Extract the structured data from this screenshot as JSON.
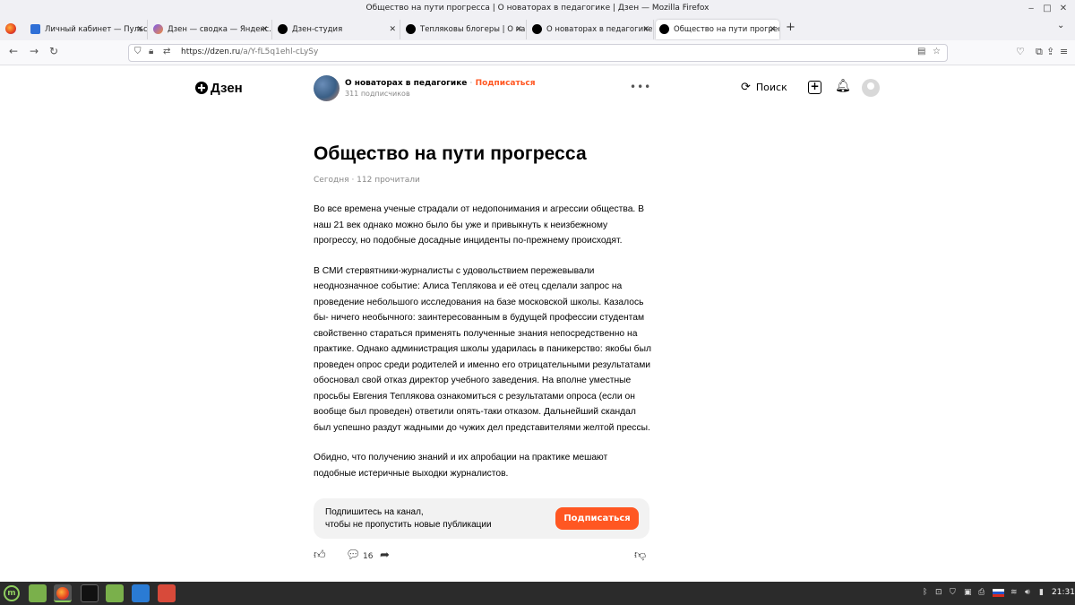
{
  "window": {
    "title": "Общество на пути прогресса | О новаторах в педагогике | Дзен — Mozilla Firefox"
  },
  "tabs": [
    {
      "label": "Личный кабинет — Пульс |",
      "color": "#2f6fd6"
    },
    {
      "label": "Дзен — сводка — Яндекс.",
      "color": "#7b5cf0"
    },
    {
      "label": "Дзен-студия",
      "color": "#000000"
    },
    {
      "label": "Тепляковы блогеры | О на",
      "color": "#000000"
    },
    {
      "label": "О новаторах в педагогике",
      "color": "#000000"
    },
    {
      "label": "Общество на пути прогрес",
      "color": "#000000"
    }
  ],
  "address": {
    "host": "https://dzen.ru",
    "path": "/a/Y-fL5q1ehl-cLySy"
  },
  "site": {
    "logo": "Дзен",
    "channel_name": "О новаторах в педагогике",
    "separator": "·",
    "subscribe_link": "Подписаться",
    "subscribers": "311 подписчиков",
    "search_label": "Поиск",
    "more": "•••"
  },
  "article": {
    "title": "Общество на пути прогресса",
    "meta": "Сегодня · 112 прочитали",
    "paragraphs": [
      "Во все времена ученые страдали от недопонимания и агрессии общества. В наш 21 век однако можно было бы уже и привыкнуть к неизбежному прогрессу, но подобные досадные инциденты по-прежнему происходят.",
      "В СМИ стервятники-журналисты с удовольствием пережевывали неоднозначное событие: Алиса Теплякова и её отец сделали запрос на проведение небольшого исследования на базе московской школы. Казалось бы- ничего необычного: заинтересованным в будущей профессии студентам свойственно стараться применять полученные знания непосредственно на практике. Однако администрация школы ударилась в паникерство: якобы был проведен опрос среди родителей и именно его отрицательными результатами обосновал свой отказ директор учебного заведения. На вполне уместные просьбы Евгения Теплякова ознакомиться с результатами опроса (если он вообще был проведен) ответили опять-таки отказом. Дальнейший скандал был успешно раздут жадными до чужих дел представителями желтой прессы.",
      "Обидно, что получению знаний и их апробации на практике мешают подобные истеричные выходки журналистов."
    ],
    "subscribe_card": {
      "line1": "Подпишитесь на канал,",
      "line2": "чтобы не пропустить новые публикации",
      "button": "Подписаться"
    },
    "comments_count": "16"
  },
  "taskbar": {
    "clock": "21:31"
  },
  "colors": {
    "accent": "#ff5722",
    "taskbar": "#2b2b2b"
  }
}
